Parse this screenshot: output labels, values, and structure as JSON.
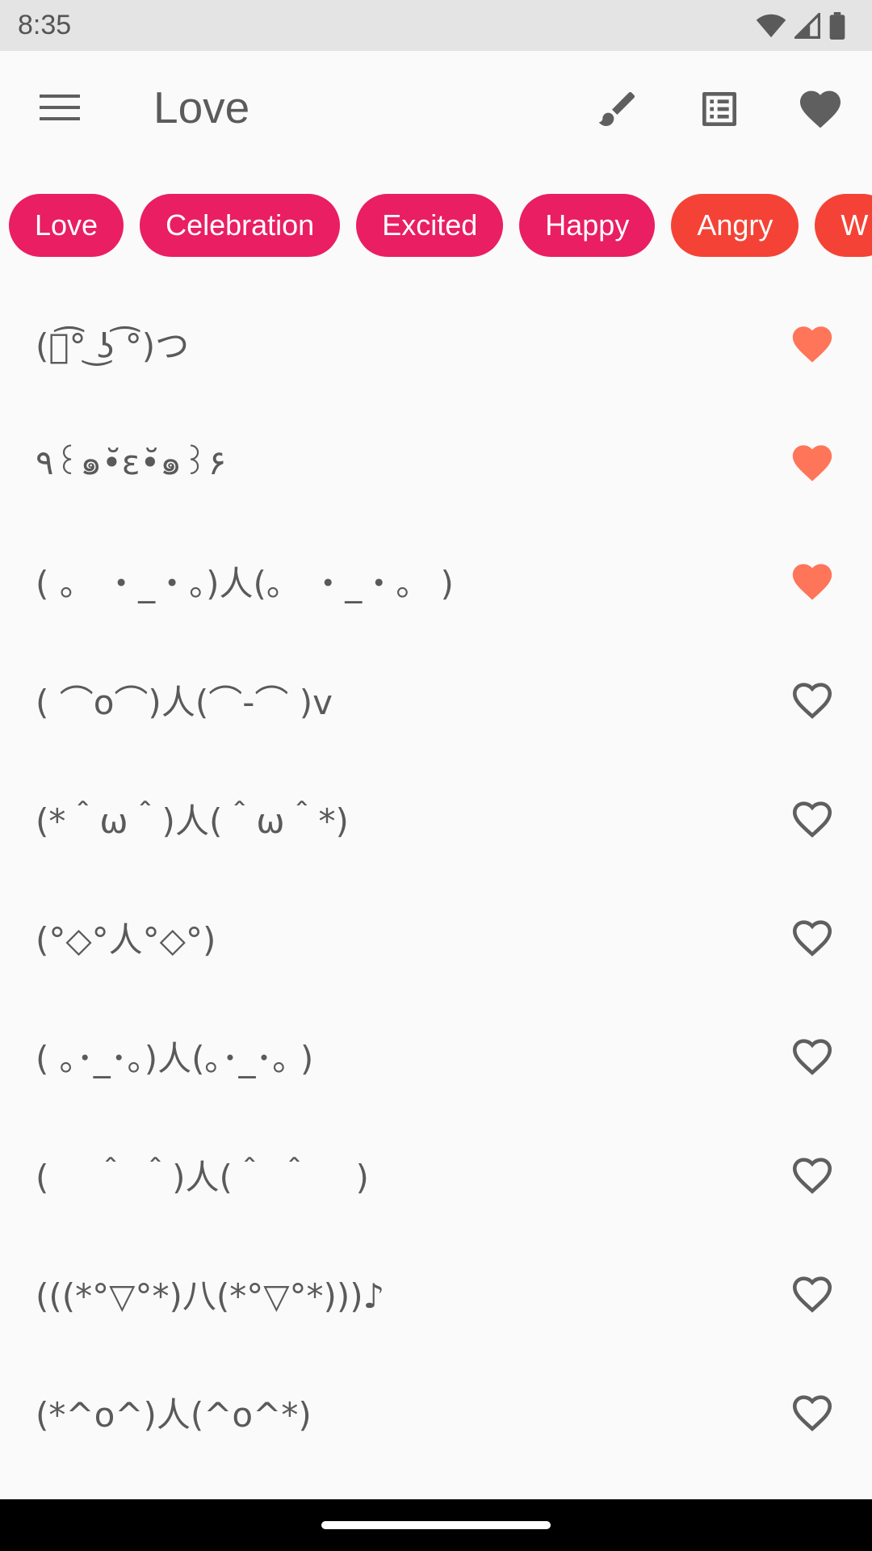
{
  "status": {
    "time": "8:35"
  },
  "app_bar": {
    "title": "Love"
  },
  "colors": {
    "chip_pink": "#E91E63",
    "chip_red": "#F44336",
    "heart_filled": "#FF7559",
    "icon_gray": "#5F5F5F"
  },
  "chips": [
    {
      "label": "Love",
      "color": "#E91E63"
    },
    {
      "label": "Celebration",
      "color": "#E91E63"
    },
    {
      "label": "Excited",
      "color": "#E91E63"
    },
    {
      "label": "Happy",
      "color": "#E91E63"
    },
    {
      "label": "Angry",
      "color": "#F44336"
    },
    {
      "label": "W",
      "color": "#F44336"
    }
  ],
  "items": [
    {
      "text": "(つ͡° ͜ʖ ͡°)つ",
      "favorite": true
    },
    {
      "text": "٩꒰๑•̆ε•̆๑꒱۶",
      "favorite": true
    },
    {
      "text": "( 。 ・_・。)人(。 ・_・。 )",
      "favorite": true
    },
    {
      "text": "( ⌒o⌒)人(⌒-⌒ )v",
      "favorite": false
    },
    {
      "text": "(*＾ω＾)人(＾ω＾*)",
      "favorite": false
    },
    {
      "text": "(°◇°人°◇°)",
      "favorite": false
    },
    {
      "text": "( ｡･_･｡)人(｡･_･｡ )",
      "favorite": false
    },
    {
      "text": "(　 ＾ ＾)人(＾ ＾　 )",
      "favorite": false
    },
    {
      "text": "(((*°▽°*)八(*°▽°*)))♪",
      "favorite": false
    },
    {
      "text": "(*^o^)人(^o^*)",
      "favorite": false
    }
  ],
  "icons": {
    "menu": "menu-icon",
    "brush": "brush-icon",
    "list": "list-icon",
    "favorites": "heart-icon"
  }
}
